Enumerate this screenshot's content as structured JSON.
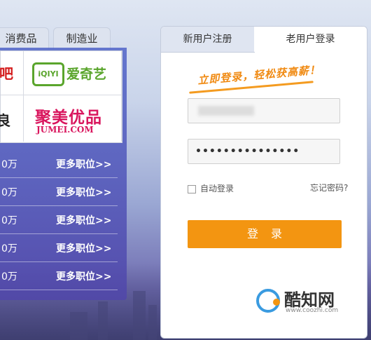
{
  "categories": {
    "tab1": "消费品",
    "tab2": "制造业"
  },
  "logos": {
    "top_left_partial": "吧",
    "iqiyi_mark": "iQIYI",
    "iqiyi_name": "爱奇艺",
    "bottom_left_partial": "良",
    "jumei_cn": "聚美优品",
    "jumei_en": "JUMEI.COM"
  },
  "jobs": [
    {
      "salary": "0万",
      "more": "更多职位>>"
    },
    {
      "salary": "0万",
      "more": "更多职位>>"
    },
    {
      "salary": "0万",
      "more": "更多职位>>"
    },
    {
      "salary": "0万",
      "more": "更多职位>>"
    },
    {
      "salary": "0万",
      "more": "更多职位>>"
    }
  ],
  "login": {
    "tab_register": "新用户注册",
    "tab_login": "老用户登录",
    "slogan": "立即登录，轻松获高薪！",
    "password_mask": "•••••••••••••••",
    "remember": "自动登录",
    "forgot": "忘记密码?",
    "submit": "登录"
  },
  "watermark": {
    "name": "酷知网",
    "url": "www.coozhi.com"
  }
}
